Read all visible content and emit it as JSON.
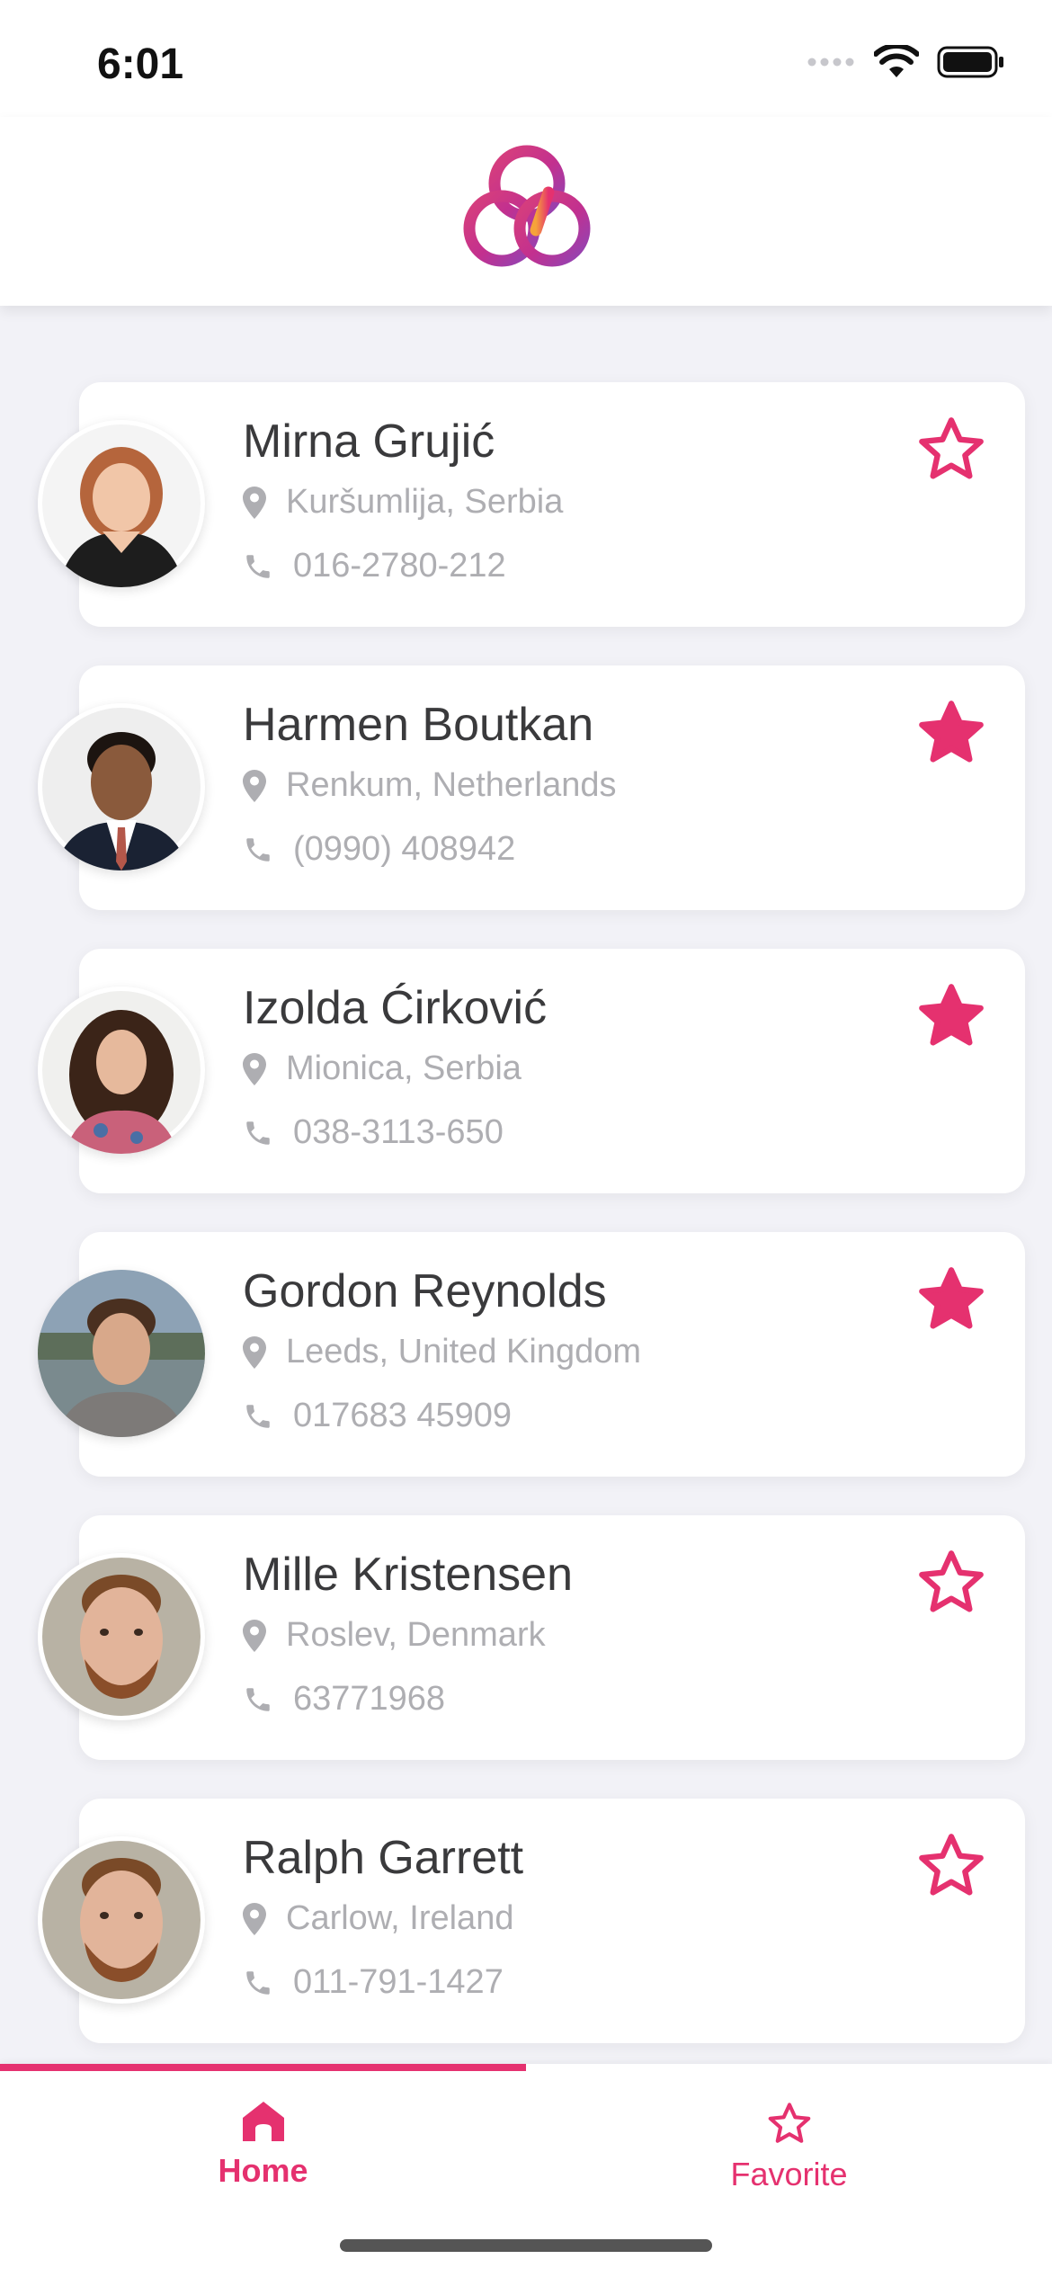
{
  "status_bar": {
    "time": "6:01"
  },
  "contacts": [
    {
      "name": "Mirna Grujić",
      "location": "Kuršumlija, Serbia",
      "phone": "016-2780-212",
      "favorite": false
    },
    {
      "name": "Harmen Boutkan",
      "location": "Renkum, Netherlands",
      "phone": "(0990) 408942",
      "favorite": true
    },
    {
      "name": "Izolda Ćirković",
      "location": "Mionica, Serbia",
      "phone": "038-3113-650",
      "favorite": true
    },
    {
      "name": "Gordon Reynolds",
      "location": "Leeds, United Kingdom",
      "phone": "017683 45909",
      "favorite": true
    },
    {
      "name": "Mille Kristensen",
      "location": "Roslev, Denmark",
      "phone": "63771968",
      "favorite": false
    },
    {
      "name": "Ralph Garrett",
      "location": "Carlow, Ireland",
      "phone": "011-791-1427",
      "favorite": false
    }
  ],
  "tabs": [
    {
      "label": "Home",
      "icon": "home-icon",
      "active": true
    },
    {
      "label": "Favorite",
      "icon": "star-icon",
      "active": false
    }
  ],
  "colors": {
    "accent": "#e5316f",
    "background": "#f2f2f7",
    "name_text": "#3a3a3c",
    "secondary_text": "#aeaeb2"
  }
}
